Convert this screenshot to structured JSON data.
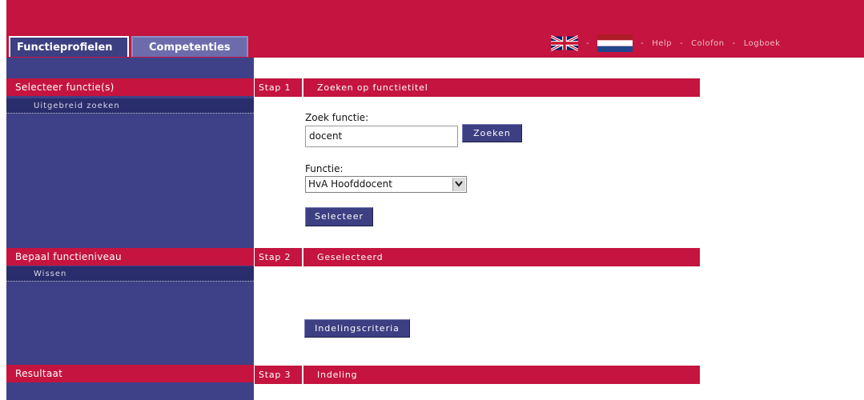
{
  "tabs": [
    {
      "label": "Functieprofielen"
    },
    {
      "label": "Competenties"
    }
  ],
  "topnav": {
    "separator": "-",
    "links": [
      "Help",
      "Colofon",
      "Logboek"
    ],
    "flags": [
      "uk-flag-icon",
      "nl-flag-icon"
    ]
  },
  "sidebar": {
    "sections": [
      {
        "header": "Selecteer functie(s)",
        "link": "Uitgebreid zoeken"
      },
      {
        "header": "Bepaal functieniveau",
        "link": "Wissen"
      },
      {
        "header": "Resultaat"
      }
    ]
  },
  "steps": [
    {
      "label": "Stap 1",
      "title": "Zoeken op functietitel"
    },
    {
      "label": "Stap 2",
      "title": "Geselecteerd"
    },
    {
      "label": "Stap 3",
      "title": "Indeling"
    }
  ],
  "form": {
    "search_label": "Zoek functie:",
    "search_value": "docent",
    "search_button": "Zoeken",
    "function_label": "Functie:",
    "function_selected": "HvA Hoofddocent",
    "select_button": "Selecteer",
    "criteria_button": "Indelingscriteria"
  },
  "colors": {
    "brand_red": "#c4143f",
    "nav_blue": "#3f4188",
    "dark_blue": "#2a2d6b"
  }
}
